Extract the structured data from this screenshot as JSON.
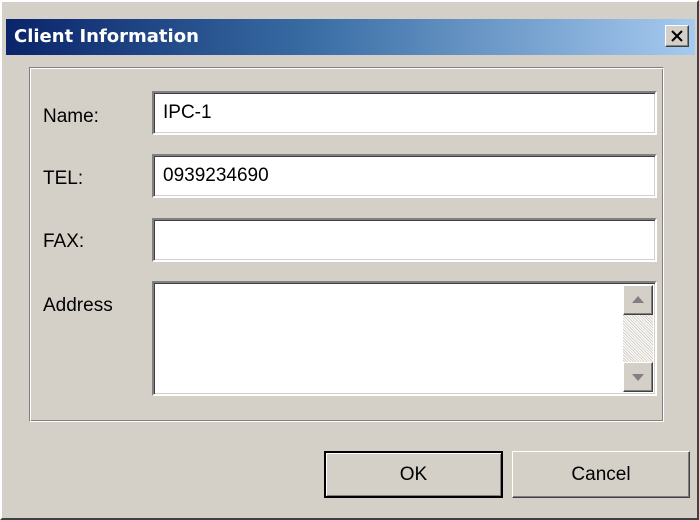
{
  "window": {
    "title": "Client Information",
    "close_label": "×"
  },
  "form": {
    "name": {
      "label": "Name:",
      "value": "IPC-1"
    },
    "tel": {
      "label": "TEL:",
      "value": "0939234690"
    },
    "fax": {
      "label": "FAX:",
      "value": ""
    },
    "address": {
      "label": "Address",
      "value": ""
    }
  },
  "buttons": {
    "ok": "OK",
    "cancel": "Cancel"
  },
  "icons": {
    "close": "close-icon",
    "scroll_up": "scroll-up-arrow-icon",
    "scroll_down": "scroll-down-arrow-icon"
  },
  "colors": {
    "title_gradient_start": "#0a246a",
    "title_gradient_end": "#a6caf0",
    "face": "#d4d0c8"
  }
}
